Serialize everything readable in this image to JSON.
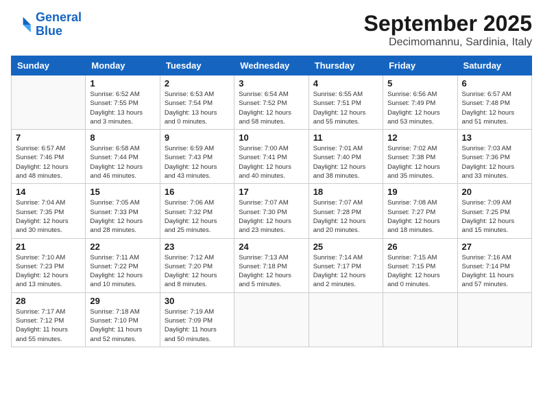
{
  "logo": {
    "line1": "General",
    "line2": "Blue"
  },
  "title": "September 2025",
  "location": "Decimomannu, Sardinia, Italy",
  "weekdays": [
    "Sunday",
    "Monday",
    "Tuesday",
    "Wednesday",
    "Thursday",
    "Friday",
    "Saturday"
  ],
  "weeks": [
    [
      {
        "day": "",
        "info": ""
      },
      {
        "day": "1",
        "info": "Sunrise: 6:52 AM\nSunset: 7:55 PM\nDaylight: 13 hours\nand 3 minutes."
      },
      {
        "day": "2",
        "info": "Sunrise: 6:53 AM\nSunset: 7:54 PM\nDaylight: 13 hours\nand 0 minutes."
      },
      {
        "day": "3",
        "info": "Sunrise: 6:54 AM\nSunset: 7:52 PM\nDaylight: 12 hours\nand 58 minutes."
      },
      {
        "day": "4",
        "info": "Sunrise: 6:55 AM\nSunset: 7:51 PM\nDaylight: 12 hours\nand 55 minutes."
      },
      {
        "day": "5",
        "info": "Sunrise: 6:56 AM\nSunset: 7:49 PM\nDaylight: 12 hours\nand 53 minutes."
      },
      {
        "day": "6",
        "info": "Sunrise: 6:57 AM\nSunset: 7:48 PM\nDaylight: 12 hours\nand 51 minutes."
      }
    ],
    [
      {
        "day": "7",
        "info": "Sunrise: 6:57 AM\nSunset: 7:46 PM\nDaylight: 12 hours\nand 48 minutes."
      },
      {
        "day": "8",
        "info": "Sunrise: 6:58 AM\nSunset: 7:44 PM\nDaylight: 12 hours\nand 46 minutes."
      },
      {
        "day": "9",
        "info": "Sunrise: 6:59 AM\nSunset: 7:43 PM\nDaylight: 12 hours\nand 43 minutes."
      },
      {
        "day": "10",
        "info": "Sunrise: 7:00 AM\nSunset: 7:41 PM\nDaylight: 12 hours\nand 40 minutes."
      },
      {
        "day": "11",
        "info": "Sunrise: 7:01 AM\nSunset: 7:40 PM\nDaylight: 12 hours\nand 38 minutes."
      },
      {
        "day": "12",
        "info": "Sunrise: 7:02 AM\nSunset: 7:38 PM\nDaylight: 12 hours\nand 35 minutes."
      },
      {
        "day": "13",
        "info": "Sunrise: 7:03 AM\nSunset: 7:36 PM\nDaylight: 12 hours\nand 33 minutes."
      }
    ],
    [
      {
        "day": "14",
        "info": "Sunrise: 7:04 AM\nSunset: 7:35 PM\nDaylight: 12 hours\nand 30 minutes."
      },
      {
        "day": "15",
        "info": "Sunrise: 7:05 AM\nSunset: 7:33 PM\nDaylight: 12 hours\nand 28 minutes."
      },
      {
        "day": "16",
        "info": "Sunrise: 7:06 AM\nSunset: 7:32 PM\nDaylight: 12 hours\nand 25 minutes."
      },
      {
        "day": "17",
        "info": "Sunrise: 7:07 AM\nSunset: 7:30 PM\nDaylight: 12 hours\nand 23 minutes."
      },
      {
        "day": "18",
        "info": "Sunrise: 7:07 AM\nSunset: 7:28 PM\nDaylight: 12 hours\nand 20 minutes."
      },
      {
        "day": "19",
        "info": "Sunrise: 7:08 AM\nSunset: 7:27 PM\nDaylight: 12 hours\nand 18 minutes."
      },
      {
        "day": "20",
        "info": "Sunrise: 7:09 AM\nSunset: 7:25 PM\nDaylight: 12 hours\nand 15 minutes."
      }
    ],
    [
      {
        "day": "21",
        "info": "Sunrise: 7:10 AM\nSunset: 7:23 PM\nDaylight: 12 hours\nand 13 minutes."
      },
      {
        "day": "22",
        "info": "Sunrise: 7:11 AM\nSunset: 7:22 PM\nDaylight: 12 hours\nand 10 minutes."
      },
      {
        "day": "23",
        "info": "Sunrise: 7:12 AM\nSunset: 7:20 PM\nDaylight: 12 hours\nand 8 minutes."
      },
      {
        "day": "24",
        "info": "Sunrise: 7:13 AM\nSunset: 7:18 PM\nDaylight: 12 hours\nand 5 minutes."
      },
      {
        "day": "25",
        "info": "Sunrise: 7:14 AM\nSunset: 7:17 PM\nDaylight: 12 hours\nand 2 minutes."
      },
      {
        "day": "26",
        "info": "Sunrise: 7:15 AM\nSunset: 7:15 PM\nDaylight: 12 hours\nand 0 minutes."
      },
      {
        "day": "27",
        "info": "Sunrise: 7:16 AM\nSunset: 7:14 PM\nDaylight: 11 hours\nand 57 minutes."
      }
    ],
    [
      {
        "day": "28",
        "info": "Sunrise: 7:17 AM\nSunset: 7:12 PM\nDaylight: 11 hours\nand 55 minutes."
      },
      {
        "day": "29",
        "info": "Sunrise: 7:18 AM\nSunset: 7:10 PM\nDaylight: 11 hours\nand 52 minutes."
      },
      {
        "day": "30",
        "info": "Sunrise: 7:19 AM\nSunset: 7:09 PM\nDaylight: 11 hours\nand 50 minutes."
      },
      {
        "day": "",
        "info": ""
      },
      {
        "day": "",
        "info": ""
      },
      {
        "day": "",
        "info": ""
      },
      {
        "day": "",
        "info": ""
      }
    ]
  ]
}
